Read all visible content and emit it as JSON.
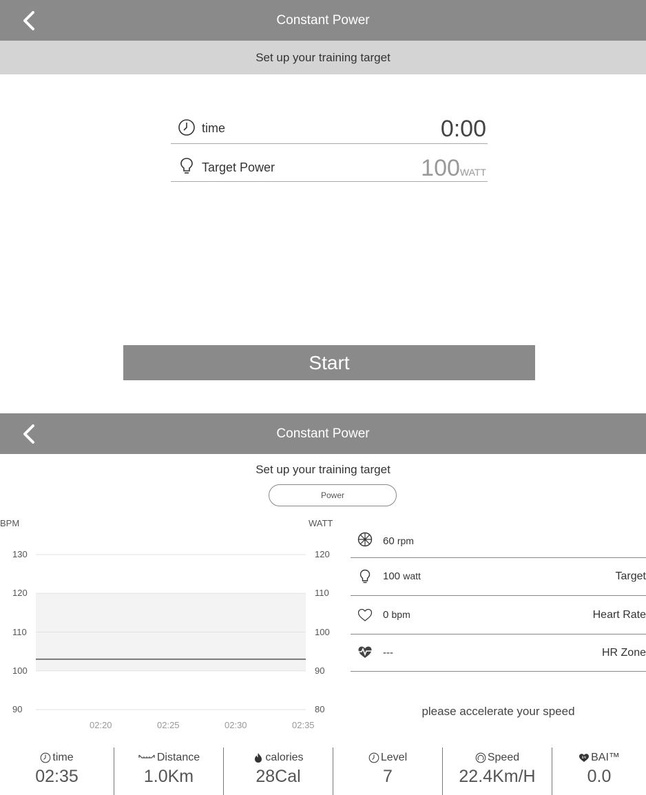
{
  "screen1": {
    "title": "Constant Power",
    "subtitle": "Set up your training target",
    "fields": [
      {
        "icon": "clock-icon",
        "label": "time",
        "value": "0:00",
        "unit": ""
      },
      {
        "icon": "bulb-icon",
        "label": "Target Power",
        "value": "100",
        "unit": "WATT"
      }
    ],
    "start_label": "Start",
    "colors": {
      "appbar": "#8a8a8a",
      "subbar": "#d4d4d4",
      "start": "#8a8a8a"
    }
  },
  "screen2": {
    "title": "Constant Power",
    "subtitle": "Set up your training target",
    "mode_pill": "Power",
    "chart": {
      "left_axis_label": "BPM",
      "right_axis_label": "WATT",
      "left_ticks": [
        "130",
        "120",
        "110",
        "100",
        "90"
      ],
      "right_ticks": [
        "120",
        "110",
        "100",
        "90",
        "80"
      ],
      "x_ticks": [
        "02:20",
        "02:25",
        "02:30",
        "02:35"
      ]
    },
    "stats": [
      {
        "icon": "cadence-icon",
        "value": "60",
        "unit": "rpm",
        "right": ""
      },
      {
        "icon": "bulb-icon",
        "value": "100",
        "unit": "watt",
        "right": "Target"
      },
      {
        "icon": "heart-outline-icon",
        "value": "0",
        "unit": "bpm",
        "right": "Heart Rate"
      },
      {
        "icon": "heart-pulse-icon",
        "value": "---",
        "unit": "",
        "right": "HR Zone"
      }
    ],
    "message": "please accelerate your speed",
    "metrics": [
      {
        "icon": "clock-icon",
        "label": "time",
        "value": "02:35"
      },
      {
        "icon": "distance-icon",
        "label": "Distance",
        "value": "1.0Km"
      },
      {
        "icon": "flame-icon",
        "label": "calories",
        "value": "28Cal"
      },
      {
        "icon": "clock-icon",
        "label": "Level",
        "value": "7"
      },
      {
        "icon": "speed-icon",
        "label": "Speed",
        "value": "22.4Km/H"
      },
      {
        "icon": "bai-heart-icon",
        "label": "BAI™",
        "value": "0.0"
      }
    ]
  },
  "chart_data": {
    "type": "line",
    "x": [
      "02:20",
      "02:25",
      "02:30",
      "02:35"
    ],
    "series": [
      {
        "values": [
          103,
          103,
          103,
          103
        ]
      }
    ],
    "ylim": [
      90,
      130
    ],
    "y2lim": [
      80,
      120
    ],
    "ylabel": "BPM",
    "y2label": "WATT",
    "shaded_band": [
      100,
      120
    ],
    "grid": true
  }
}
